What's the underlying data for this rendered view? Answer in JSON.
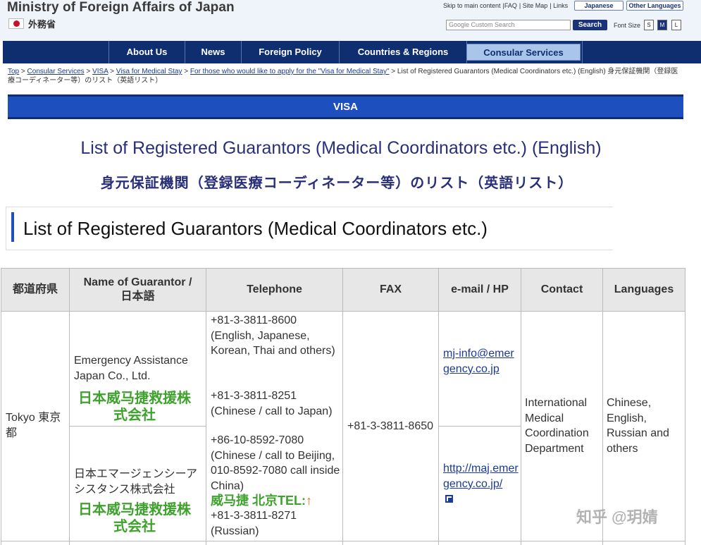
{
  "header": {
    "site_title": "Ministry of Foreign Affairs of Japan",
    "site_title_jp": "外務省",
    "top_links": [
      "Skip to main content",
      "|FAQ",
      "| Site Map",
      "| Links"
    ],
    "lang_japanese": "Japanese",
    "lang_other": "Other Languages",
    "search_placeholder": "Google Custom Search",
    "search_button": "Search",
    "font_size_label": "Font Size",
    "font_sizes": [
      "S",
      "M",
      "L"
    ]
  },
  "nav": {
    "items": [
      "About Us",
      "News",
      "Foreign Policy",
      "Countries & Regions",
      "Consular Services"
    ],
    "active": "Consular Services"
  },
  "breadcrumb": {
    "links": [
      "Top",
      "Consular Services",
      "VISA",
      "Visa for Medical Stay",
      "For those who would like to apply for the \"Visa for Medical Stay\""
    ],
    "current": "List of Registered Guarantors (Medical Coordinators etc.) (English) 身元保証機関（登録医療コーディネーター等）のリスト（英語リスト）"
  },
  "visa_banner": "VISA",
  "page_title_en": "List of Registered Guarantors (Medical Coordinators etc.) (English)",
  "page_title_jp": "身元保証機関（登録医療コーディネーター等）のリスト（英語リスト）",
  "section_title": "List of Registered Guarantors (Medical Coordinators etc.)",
  "table": {
    "headers": [
      "都道府県",
      "Name of Guarantor / 日本語",
      "Telephone",
      "FAX",
      "e-mail / HP",
      "Contact",
      "Languages"
    ],
    "row": {
      "prefecture": "Tokyo 東京都",
      "name_en": "Emergency Assistance Japan Co., Ltd.",
      "name_en_note": "日本威马捷救援株式会社",
      "name_jp": "日本エマージェンシーアシスタンス株式会社",
      "name_jp_note": "日本威马捷救援株式会社",
      "tel_1": "+81-3-3811-8600 (English, Japanese, Korean, Thai and others)",
      "tel_2": "+81-3-3811-8251 (Chinese / call to Japan)",
      "tel_3": "+86-10-8592-7080 (Chinese / call to Beijing, 010-8592-7080 call inside China)",
      "tel_note": "威马捷 北京TEL:",
      "tel_4": "+81-3-3811-8271 (Russian)",
      "fax": "+81-3-3811-8650",
      "email": "mj-info@emergency.co.jp",
      "hp": "http://maj.emergency.co.jp/",
      "contact": "International Medical Coordination Department",
      "languages": "Chinese, English, Russian and others"
    }
  },
  "watermark": "知乎 @玥婧"
}
